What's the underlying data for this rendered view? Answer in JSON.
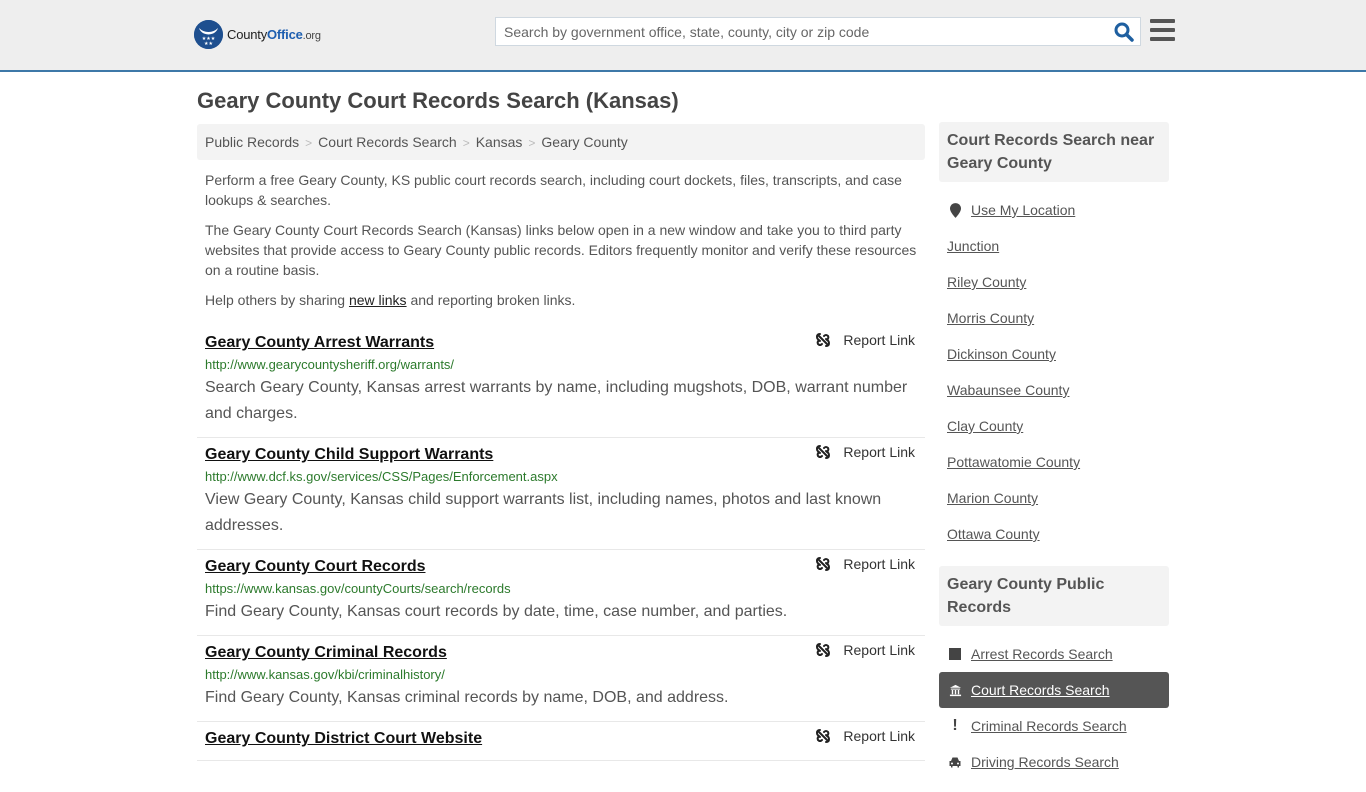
{
  "header": {
    "logo": {
      "part1": "County",
      "part2": "Office",
      "part3": ".org"
    },
    "search_placeholder": "Search by government office, state, county, city or zip code",
    "search_value": ""
  },
  "page_title": "Geary County Court Records Search (Kansas)",
  "breadcrumb": [
    "Public Records",
    "Court Records Search",
    "Kansas",
    "Geary County"
  ],
  "intro": {
    "p1": "Perform a free Geary County, KS public court records search, including court dockets, files, transcripts, and case lookups & searches.",
    "p2": "The Geary County Court Records Search (Kansas) links below open in a new window and take you to third party websites that provide access to Geary County public records. Editors frequently monitor and verify these resources on a routine basis.",
    "p3_before": "Help others by sharing ",
    "p3_link": "new links",
    "p3_after": " and reporting broken links."
  },
  "report_label": "Report Link",
  "results": [
    {
      "title": "Geary County Arrest Warrants",
      "url": "http://www.gearycountysheriff.org/warrants/",
      "desc": "Search Geary County, Kansas arrest warrants by name, including mugshots, DOB, warrant number and charges."
    },
    {
      "title": "Geary County Child Support Warrants",
      "url": "http://www.dcf.ks.gov/services/CSS/Pages/Enforcement.aspx",
      "desc": "View Geary County, Kansas child support warrants list, including names, photos and last known addresses."
    },
    {
      "title": "Geary County Court Records",
      "url": "https://www.kansas.gov/countyCourts/search/records",
      "desc": "Find Geary County, Kansas court records by date, time, case number, and parties."
    },
    {
      "title": "Geary County Criminal Records",
      "url": "http://www.kansas.gov/kbi/criminalhistory/",
      "desc": "Find Geary County, Kansas criminal records by name, DOB, and address."
    },
    {
      "title": "Geary County District Court Website",
      "url": "",
      "desc": ""
    }
  ],
  "sidebar": {
    "nearby_heading": "Court Records Search near Geary County",
    "use_location": "Use My Location",
    "nearby": [
      "Junction",
      "Riley County",
      "Morris County",
      "Dickinson County",
      "Wabaunsee County",
      "Clay County",
      "Pottawatomie County",
      "Marion County",
      "Ottawa County"
    ],
    "public_heading": "Geary County Public Records",
    "public_links": [
      {
        "label": "Arrest Records Search",
        "icon": "square-icon",
        "active": false
      },
      {
        "label": "Court Records Search",
        "icon": "courthouse-icon",
        "active": true
      },
      {
        "label": "Criminal Records Search",
        "icon": "exclamation-icon",
        "active": false
      },
      {
        "label": "Driving Records Search",
        "icon": "car-icon",
        "active": false
      }
    ]
  }
}
